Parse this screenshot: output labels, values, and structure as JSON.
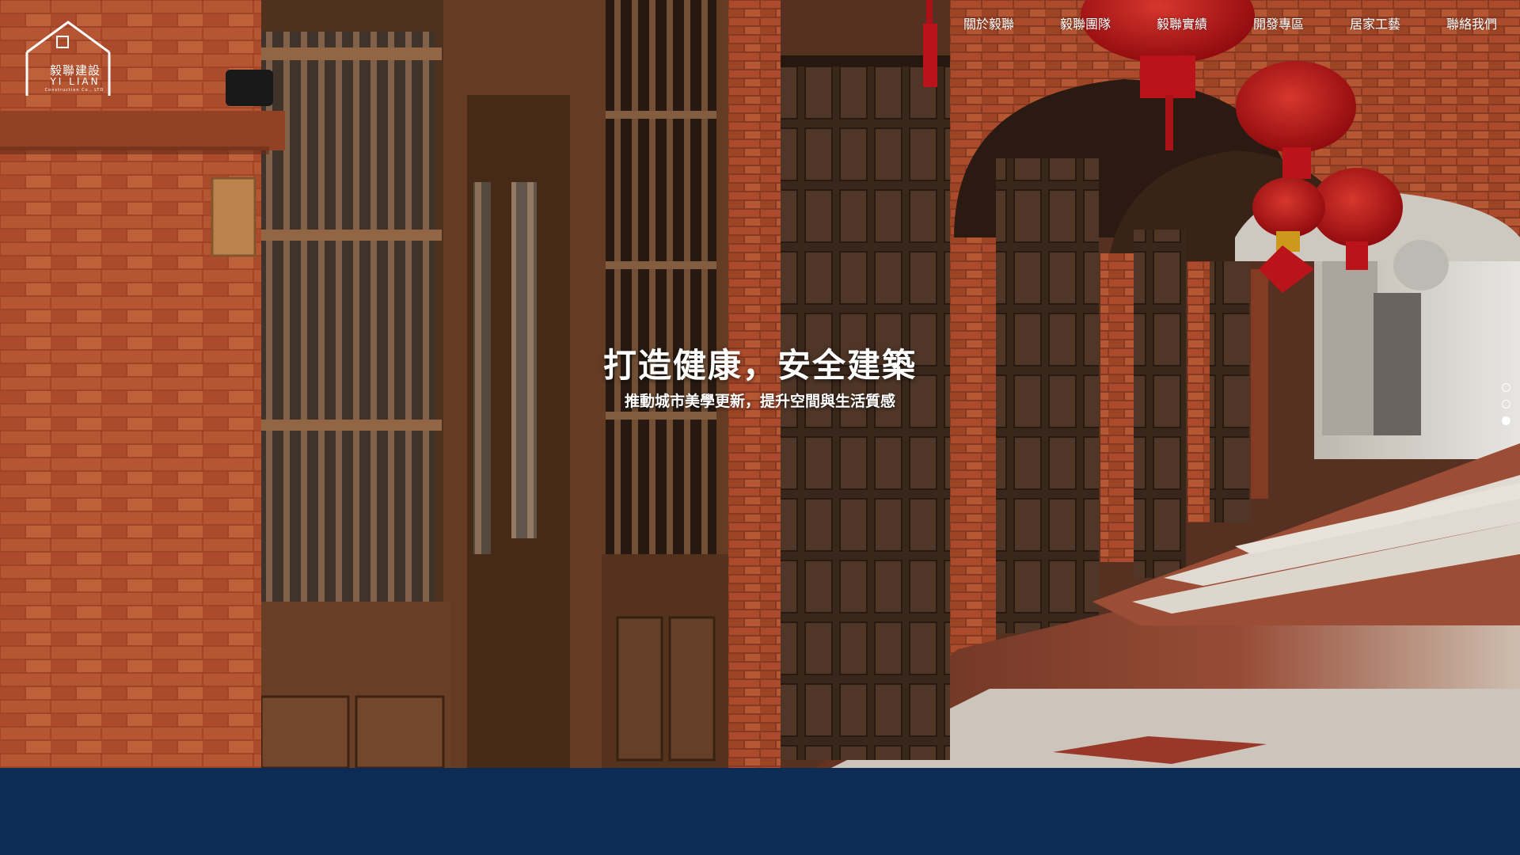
{
  "header": {
    "logo": {
      "name_cn": "毅聯建設",
      "name_en": "YI LIAN",
      "tagline": "Construction Co., LTD"
    },
    "nav": [
      {
        "label": "關於毅聯"
      },
      {
        "label": "毅聯團隊"
      },
      {
        "label": "毅聯實績"
      },
      {
        "label": "開發專區"
      },
      {
        "label": "居家工藝"
      },
      {
        "label": "聯絡我們"
      }
    ]
  },
  "hero": {
    "title": "打造健康，安全建築",
    "subtitle": "推動城市美學更新，提升空間與生活質感",
    "slides_total": 3,
    "active_slide": 3
  },
  "colors": {
    "band": "#0c2c55",
    "brick": "#b2502e",
    "wood": "#5a3420",
    "lantern": "#c4151b"
  }
}
